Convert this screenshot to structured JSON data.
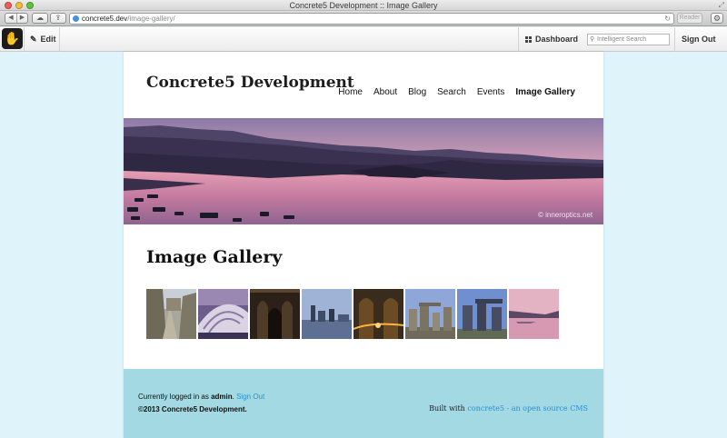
{
  "browser": {
    "window_title": "Concrete5 Development :: Image Gallery",
    "url_host": "concrete5.dev",
    "url_path": "/image-gallery/",
    "reader_label": "Reader"
  },
  "cms_toolbar": {
    "logo_icon": "concrete5-hand-icon",
    "edit_label": "Edit",
    "dashboard_label": "Dashboard",
    "search_placeholder": "Intelligent Search",
    "signout_label": "Sign Out"
  },
  "site": {
    "title": "Concrete5 Development",
    "nav": [
      {
        "label": "Home",
        "active": false
      },
      {
        "label": "About",
        "active": false
      },
      {
        "label": "Blog",
        "active": false
      },
      {
        "label": "Search",
        "active": false
      },
      {
        "label": "Events",
        "active": false
      },
      {
        "label": "Image Gallery",
        "active": true
      }
    ]
  },
  "banner": {
    "credit": "© inneroptics.net"
  },
  "main": {
    "heading": "Image Gallery",
    "thumbnails": [
      "street",
      "arches",
      "cathedral",
      "waterfront",
      "lights",
      "stones",
      "megaliths",
      "lake"
    ]
  },
  "footer": {
    "login_prefix": "Currently logged in as",
    "username": "admin",
    "signout_link": "Sign Out",
    "copyright": "©2013 Concrete5 Development.",
    "built_prefix": "Built with",
    "built_link": "concrete5 - an open source CMS"
  },
  "colors": {
    "page_background": "#dff3fb",
    "footer_background": "#a2d9e3",
    "link": "#2d8fd0"
  }
}
